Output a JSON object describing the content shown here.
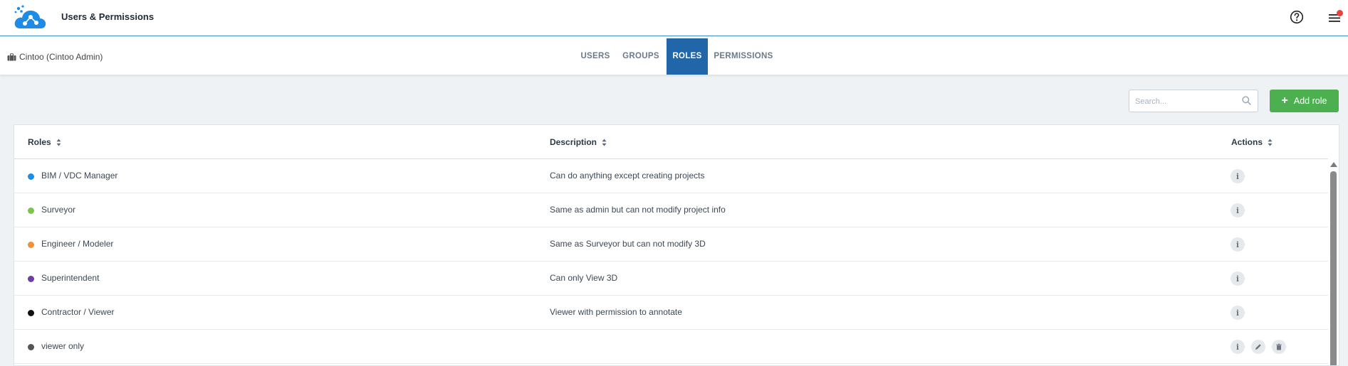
{
  "header": {
    "app_title": "Users & Permissions"
  },
  "subnav": {
    "organization": "Cintoo (Cintoo Admin)",
    "tabs": [
      {
        "label": "USERS",
        "active": false
      },
      {
        "label": "GROUPS",
        "active": false
      },
      {
        "label": "ROLES",
        "active": true
      },
      {
        "label": "PERMISSIONS",
        "active": false
      }
    ]
  },
  "toolbar": {
    "search_placeholder": "Search...",
    "add_label": "Add role"
  },
  "table": {
    "columns": [
      "Roles",
      "Description",
      "Actions"
    ],
    "rows": [
      {
        "name": "BIM / VDC Manager",
        "description": "Can do anything except creating projects",
        "color": "#1a8fe3",
        "editable": false
      },
      {
        "name": "Surveyor",
        "description": "Same as admin but can not modify project info",
        "color": "#7cc44e",
        "editable": false
      },
      {
        "name": "Engineer / Modeler",
        "description": "Same as Surveyor but can not modify 3D",
        "color": "#f0913a",
        "editable": false
      },
      {
        "name": "Superintendent",
        "description": "Can only View 3D",
        "color": "#6a3fa8",
        "editable": false
      },
      {
        "name": "Contractor / Viewer",
        "description": "Viewer with permission to annotate",
        "color": "#111111",
        "editable": false
      },
      {
        "name": "viewer only",
        "description": "",
        "color": "#555555",
        "editable": true
      }
    ]
  },
  "colors": {
    "accent": "#2266aa",
    "add_button": "#4caf50",
    "notification": "#e8433b"
  },
  "icons": {
    "logo": "cloud-logo-icon",
    "help": "help-circle-icon",
    "menu": "hamburger-menu-icon",
    "organization": "briefcase-icon",
    "search": "search-icon",
    "add": "plus-icon",
    "sort": "sort-icon",
    "info": "info-icon",
    "edit": "pencil-icon",
    "delete": "trash-icon"
  }
}
